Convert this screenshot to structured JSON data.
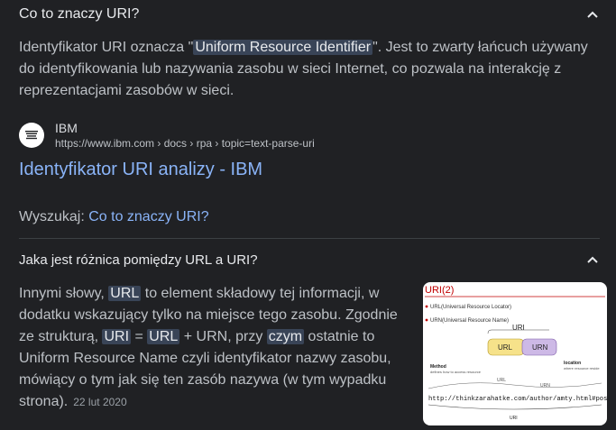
{
  "q1": {
    "question": "Co to znaczy URI?",
    "answer_pre": "Identyfikator URI oznacza \"",
    "answer_hl": "Uniform Resource Identifier",
    "answer_post": "\". Jest to zwarty łańcuch używany do identyfikowania lub nazywania zasobu w sieci Internet, co pozwala na interakcję z reprezentacjami zasobów w sieci."
  },
  "source": {
    "name": "IBM",
    "url": "https://www.ibm.com › docs › rpa › topic=text-parse-uri",
    "title": "Identyfikator URI analizy - IBM"
  },
  "search": {
    "label": "Wyszukaj:",
    "query": "Co to znaczy URI?"
  },
  "q2": {
    "question": "Jaka jest różnica pomiędzy URL a URI?",
    "t1": "Innymi słowy, ",
    "h1": "URL",
    "t2": " to element składowy tej informacji, w dodatku wskazujący tylko na miejsce tego zasobu. Zgodnie ze strukturą, ",
    "h2": "URI",
    "t3": " = ",
    "h3": "URL",
    "t4": " + URN, przy ",
    "h4": "czym",
    "t5": " ostatnie to Uniform Resource Name czyli identyfikator nazwy zasobu, mówiący o tym jak się ten zasób nazywa (w tym wypadku strona).",
    "date": "22 lut 2020"
  },
  "diagram": {
    "title": "URI(2)",
    "line1": "URL(Universal Resource Locator)",
    "line2": "URN(Universal Resource Name)",
    "uri": "URI",
    "url": "URL",
    "urn": "URN",
    "method": "Method",
    "method_sub": "defines how to access resource",
    "location": "location",
    "location_sub": "where resource reside",
    "url_small": "URL",
    "urn_small": "URN",
    "link": "http://thinkzarahatke.com/author/amty.html#posts",
    "uri_bottom": "URI"
  },
  "colors": {
    "background": "#202124",
    "link": "#8ab4f8",
    "highlight": "#394457"
  }
}
